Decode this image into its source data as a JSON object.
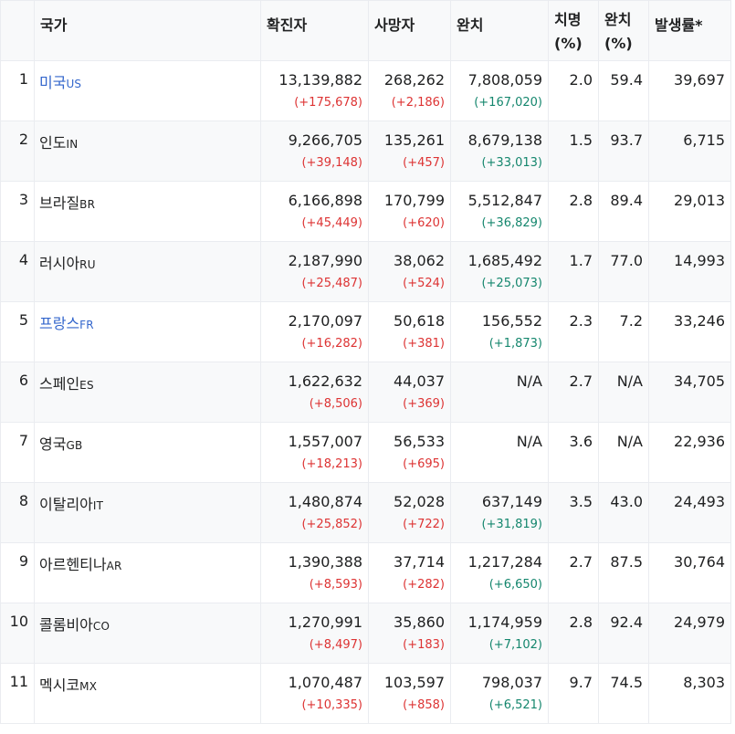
{
  "headers": {
    "country": "국가",
    "confirmed": "확진자",
    "deaths": "사망자",
    "recovered": "완치",
    "fatality": [
      "치명",
      "(%)"
    ],
    "recovery_rate": [
      "완치",
      "(%)"
    ],
    "incidence": "발생률*"
  },
  "colors": {
    "link": "#3366cc",
    "increase": "#dd3333",
    "recovered_increase": "#14866d",
    "stripe": "#f8f9fa"
  },
  "rows": [
    {
      "rank": "1",
      "name": "미국",
      "code": "US",
      "link": true,
      "confirmed": "13,139,882",
      "confirmed_delta": "(+175,678)",
      "deaths": "268,262",
      "deaths_delta": "(+2,186)",
      "recovered": "7,808,059",
      "recovered_delta": "(+167,020)",
      "fatality": "2.0",
      "recovery_rate": "59.4",
      "incidence": "39,697"
    },
    {
      "rank": "2",
      "name": "인도",
      "code": "IN",
      "link": false,
      "confirmed": "9,266,705",
      "confirmed_delta": "(+39,148)",
      "deaths": "135,261",
      "deaths_delta": "(+457)",
      "recovered": "8,679,138",
      "recovered_delta": "(+33,013)",
      "fatality": "1.5",
      "recovery_rate": "93.7",
      "incidence": "6,715"
    },
    {
      "rank": "3",
      "name": "브라질",
      "code": "BR",
      "link": false,
      "confirmed": "6,166,898",
      "confirmed_delta": "(+45,449)",
      "deaths": "170,799",
      "deaths_delta": "(+620)",
      "recovered": "5,512,847",
      "recovered_delta": "(+36,829)",
      "fatality": "2.8",
      "recovery_rate": "89.4",
      "incidence": "29,013"
    },
    {
      "rank": "4",
      "name": "러시아",
      "code": "RU",
      "link": false,
      "confirmed": "2,187,990",
      "confirmed_delta": "(+25,487)",
      "deaths": "38,062",
      "deaths_delta": "(+524)",
      "recovered": "1,685,492",
      "recovered_delta": "(+25,073)",
      "fatality": "1.7",
      "recovery_rate": "77.0",
      "incidence": "14,993"
    },
    {
      "rank": "5",
      "name": "프랑스",
      "code": "FR",
      "link": true,
      "confirmed": "2,170,097",
      "confirmed_delta": "(+16,282)",
      "deaths": "50,618",
      "deaths_delta": "(+381)",
      "recovered": "156,552",
      "recovered_delta": "(+1,873)",
      "fatality": "2.3",
      "recovery_rate": "7.2",
      "incidence": "33,246"
    },
    {
      "rank": "6",
      "name": "스페인",
      "code": "ES",
      "link": false,
      "confirmed": "1,622,632",
      "confirmed_delta": "(+8,506)",
      "deaths": "44,037",
      "deaths_delta": "(+369)",
      "recovered": "N/A",
      "recovered_delta": "",
      "fatality": "2.7",
      "recovery_rate": "N/A",
      "incidence": "34,705"
    },
    {
      "rank": "7",
      "name": "영국",
      "code": "GB",
      "link": false,
      "confirmed": "1,557,007",
      "confirmed_delta": "(+18,213)",
      "deaths": "56,533",
      "deaths_delta": "(+695)",
      "recovered": "N/A",
      "recovered_delta": "",
      "fatality": "3.6",
      "recovery_rate": "N/A",
      "incidence": "22,936"
    },
    {
      "rank": "8",
      "name": "이탈리아",
      "code": "IT",
      "link": false,
      "confirmed": "1,480,874",
      "confirmed_delta": "(+25,852)",
      "deaths": "52,028",
      "deaths_delta": "(+722)",
      "recovered": "637,149",
      "recovered_delta": "(+31,819)",
      "fatality": "3.5",
      "recovery_rate": "43.0",
      "incidence": "24,493"
    },
    {
      "rank": "9",
      "name": "아르헨티나",
      "code": "AR",
      "link": false,
      "confirmed": "1,390,388",
      "confirmed_delta": "(+8,593)",
      "deaths": "37,714",
      "deaths_delta": "(+282)",
      "recovered": "1,217,284",
      "recovered_delta": "(+6,650)",
      "fatality": "2.7",
      "recovery_rate": "87.5",
      "incidence": "30,764"
    },
    {
      "rank": "10",
      "name": "콜롬비아",
      "code": "CO",
      "link": false,
      "confirmed": "1,270,991",
      "confirmed_delta": "(+8,497)",
      "deaths": "35,860",
      "deaths_delta": "(+183)",
      "recovered": "1,174,959",
      "recovered_delta": "(+7,102)",
      "fatality": "2.8",
      "recovery_rate": "92.4",
      "incidence": "24,979"
    },
    {
      "rank": "11",
      "name": "멕시코",
      "code": "MX",
      "link": false,
      "confirmed": "1,070,487",
      "confirmed_delta": "(+10,335)",
      "deaths": "103,597",
      "deaths_delta": "(+858)",
      "recovered": "798,037",
      "recovered_delta": "(+6,521)",
      "fatality": "9.7",
      "recovery_rate": "74.5",
      "incidence": "8,303"
    }
  ]
}
